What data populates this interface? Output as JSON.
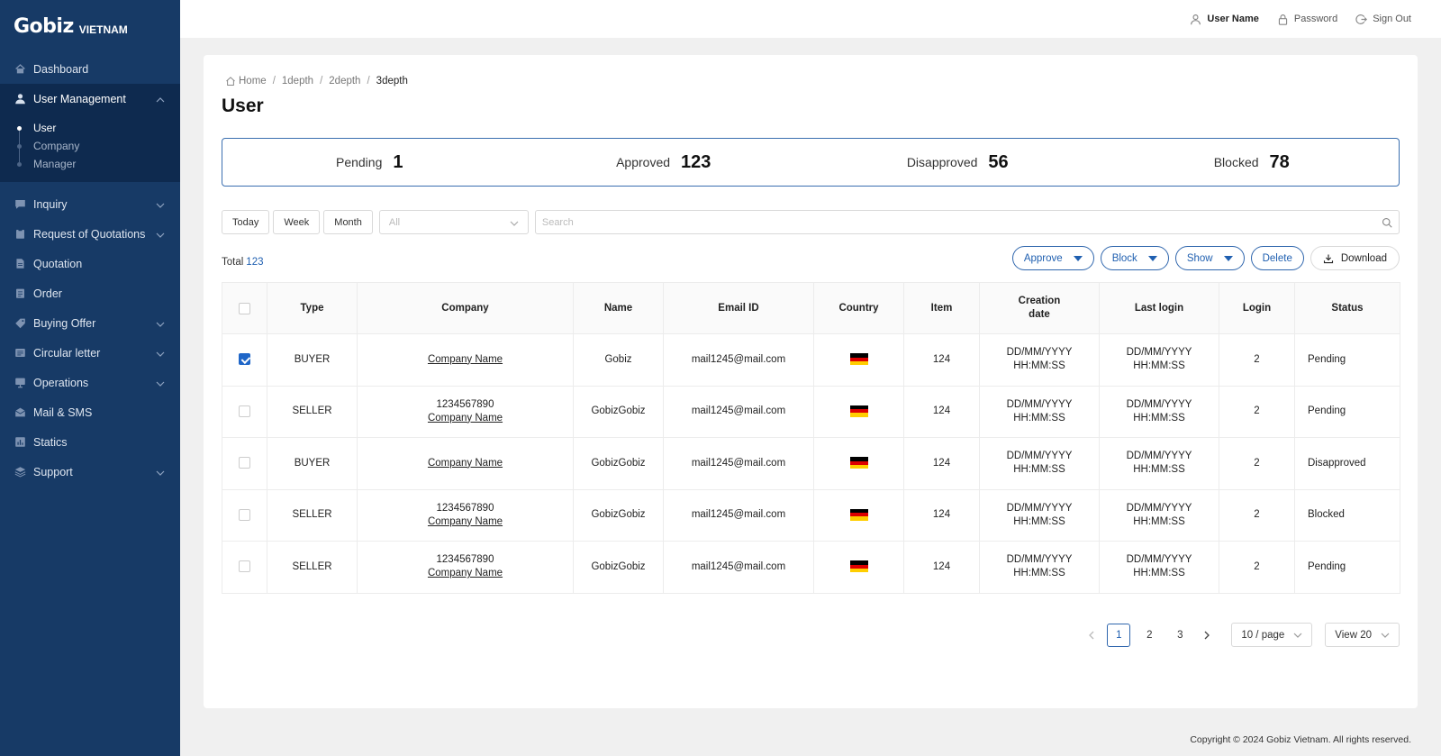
{
  "brand": {
    "name": "Gobiz",
    "sub": "VIETNAM"
  },
  "sidebar": {
    "items": [
      {
        "label": "Dashboard",
        "icon": "home-icon"
      },
      {
        "label": "User Management",
        "icon": "user-icon",
        "active": true,
        "sub": [
          {
            "label": "User",
            "active": true
          },
          {
            "label": "Company"
          },
          {
            "label": "Manager"
          }
        ]
      },
      {
        "label": "Inquiry",
        "icon": "chat-icon",
        "expandable": true
      },
      {
        "label": "Request of Quotations",
        "icon": "clipboard-icon",
        "expandable": true
      },
      {
        "label": "Quotation",
        "icon": "document-icon"
      },
      {
        "label": "Order",
        "icon": "order-icon"
      },
      {
        "label": "Buying Offer",
        "icon": "tag-icon",
        "expandable": true
      },
      {
        "label": "Circular letter",
        "icon": "letter-icon",
        "expandable": true
      },
      {
        "label": "Operations",
        "icon": "monitor-icon",
        "expandable": true
      },
      {
        "label": "Mail & SMS",
        "icon": "mail-icon"
      },
      {
        "label": "Statics",
        "icon": "chart-icon"
      },
      {
        "label": "Support",
        "icon": "layers-icon",
        "expandable": true
      }
    ]
  },
  "topbar": {
    "user": "User Name",
    "password": "Password",
    "signout": "Sign Out"
  },
  "breadcrumb": [
    "Home",
    "1depth",
    "2depth",
    "3depth"
  ],
  "page_title": "User",
  "stats": [
    {
      "label": "Pending",
      "value": "1"
    },
    {
      "label": "Approved",
      "value": "123"
    },
    {
      "label": "Disapproved",
      "value": "56"
    },
    {
      "label": "Blocked",
      "value": "78"
    }
  ],
  "filters": {
    "buttons": [
      "Today",
      "Week",
      "Month"
    ],
    "select": "All",
    "search_placeholder": "Search"
  },
  "total": {
    "label": "Total",
    "value": "123"
  },
  "actions": {
    "approve": "Approve",
    "block": "Block",
    "show": "Show",
    "delete": "Delete",
    "download": "Download"
  },
  "table": {
    "columns": [
      "Type",
      "Company",
      "Name",
      "Email ID",
      "Country",
      "Item",
      "Creation date",
      "Last login",
      "Login",
      "Status"
    ],
    "rows": [
      {
        "checked": true,
        "type": "BUYER",
        "company_code": "",
        "company": "Company Name",
        "name": "Gobiz",
        "email": "mail1245@mail.com",
        "item": "124",
        "created_date": "DD/MM/YYYY",
        "created_time": "HH:MM:SS",
        "login_date": "DD/MM/YYYY",
        "login_time": "HH:MM:SS",
        "login": "2",
        "status": "Pending"
      },
      {
        "checked": false,
        "type": "SELLER",
        "company_code": "1234567890",
        "company": "Company Name",
        "name": "GobizGobiz",
        "email": "mail1245@mail.com",
        "item": "124",
        "created_date": "DD/MM/YYYY",
        "created_time": "HH:MM:SS",
        "login_date": "DD/MM/YYYY",
        "login_time": "HH:MM:SS",
        "login": "2",
        "status": "Pending"
      },
      {
        "checked": false,
        "type": "BUYER",
        "company_code": "",
        "company": "Company Name",
        "name": "GobizGobiz",
        "email": "mail1245@mail.com",
        "item": "124",
        "created_date": "DD/MM/YYYY",
        "created_time": "HH:MM:SS",
        "login_date": "DD/MM/YYYY",
        "login_time": "HH:MM:SS",
        "login": "2",
        "status": "Disapproved"
      },
      {
        "checked": false,
        "type": "SELLER",
        "company_code": "1234567890",
        "company": "Company Name",
        "name": "GobizGobiz",
        "email": "mail1245@mail.com",
        "item": "124",
        "created_date": "DD/MM/YYYY",
        "created_time": "HH:MM:SS",
        "login_date": "DD/MM/YYYY",
        "login_time": "HH:MM:SS",
        "login": "2",
        "status": "Blocked"
      },
      {
        "checked": false,
        "type": "SELLER",
        "company_code": "1234567890",
        "company": "Company Name",
        "name": "GobizGobiz",
        "email": "mail1245@mail.com",
        "item": "124",
        "created_date": "DD/MM/YYYY",
        "created_time": "HH:MM:SS",
        "login_date": "DD/MM/YYYY",
        "login_time": "HH:MM:SS",
        "login": "2",
        "status": "Pending"
      }
    ]
  },
  "flag_colors": [
    "#000000",
    "#dd0000",
    "#ffce00"
  ],
  "pagination": {
    "pages": [
      "1",
      "2",
      "3"
    ],
    "current": "1",
    "per_page": "10 / page",
    "view": "View 20"
  },
  "footer": "Copyright © 2024 Gobiz Vietnam. All rights reserved."
}
